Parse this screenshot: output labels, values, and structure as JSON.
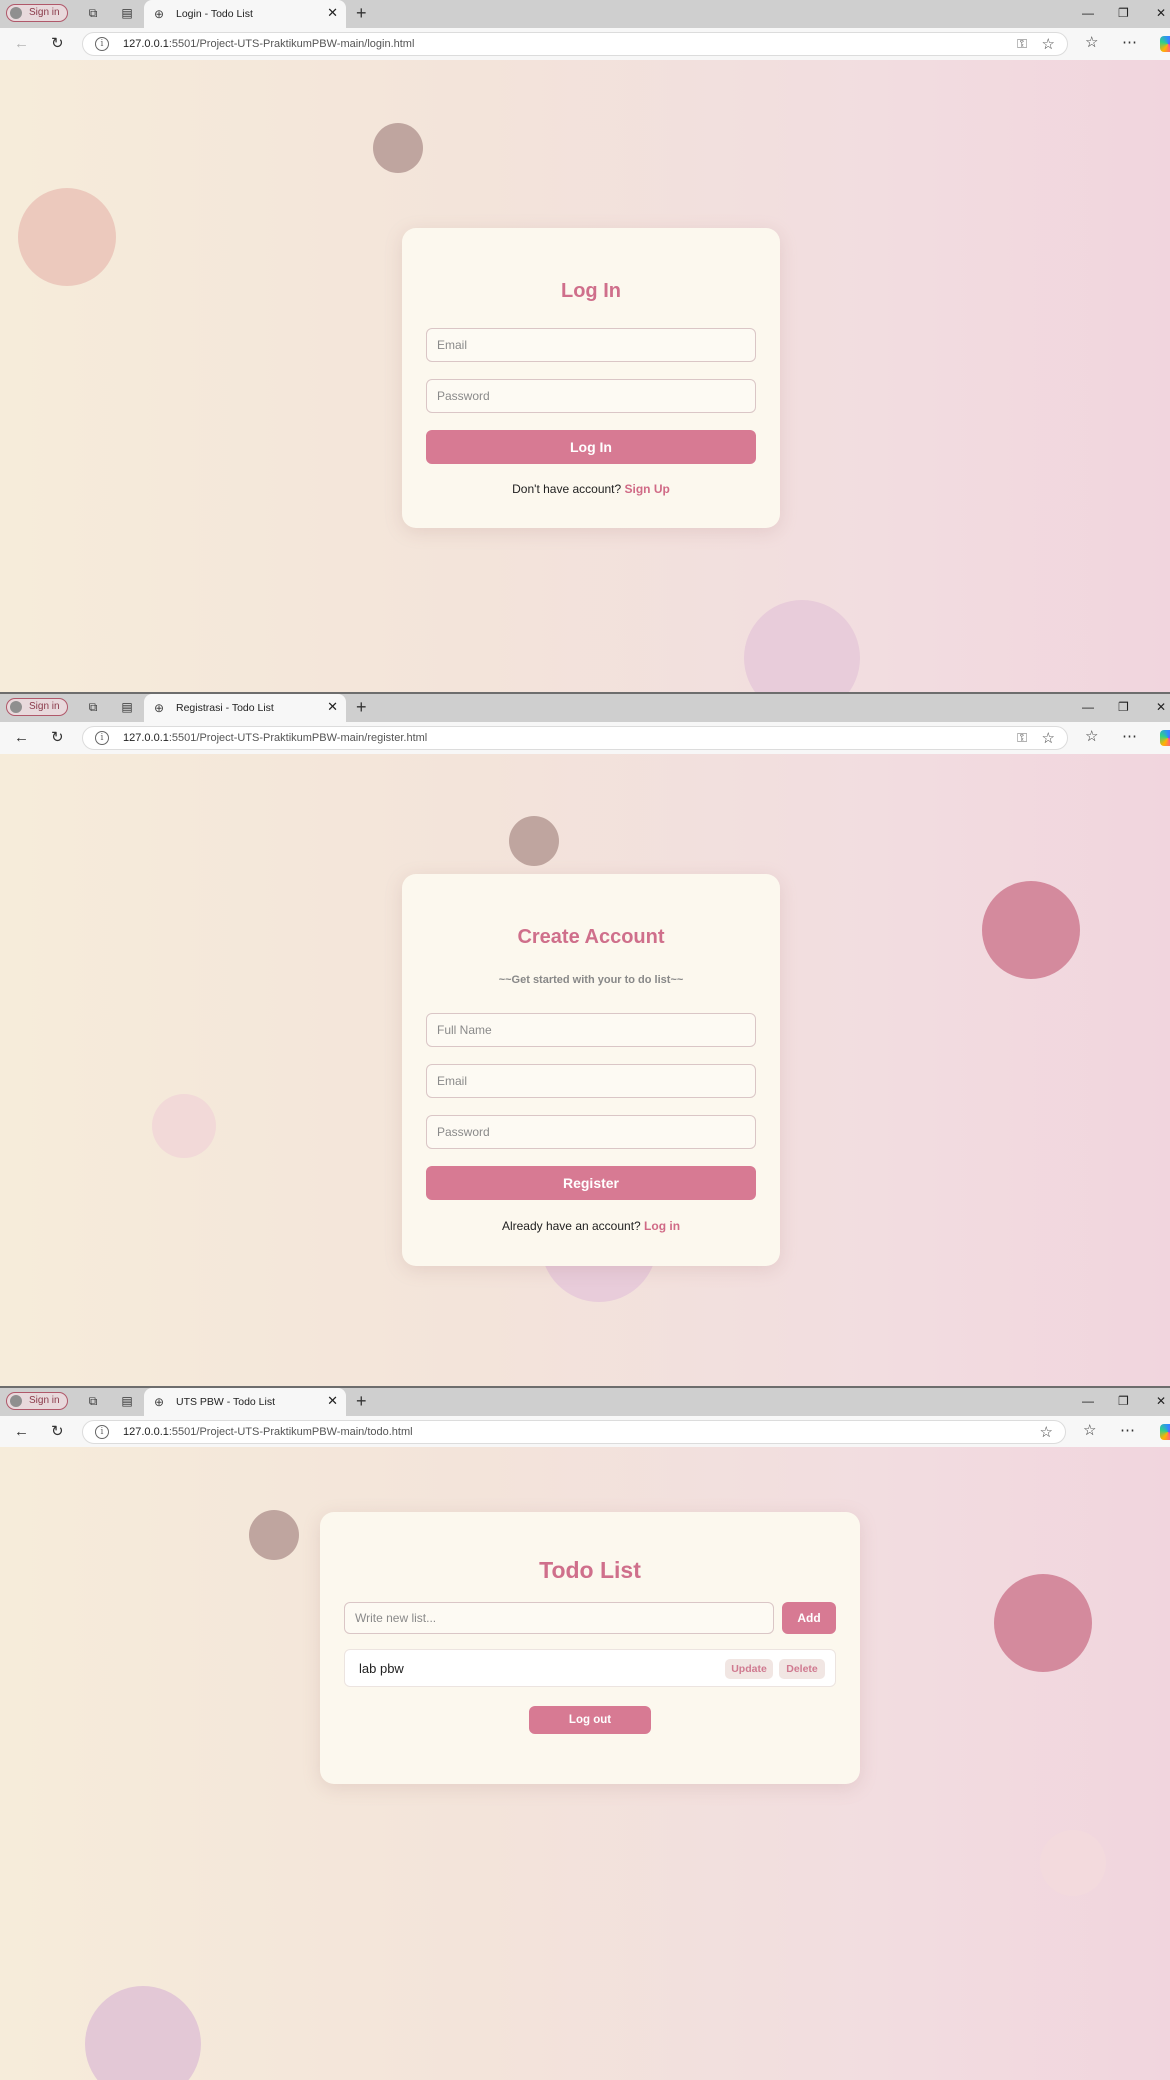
{
  "browser": {
    "sign_in_label": "Sign in",
    "screens": [
      {
        "tab_title": "Login - Todo List",
        "url_host": "127.0.0.1",
        "url_rest": ":5501/Project-UTS-PraktikumPBW-main/login.html"
      },
      {
        "tab_title": "Registrasi - Todo List",
        "url_host": "127.0.0.1",
        "url_rest": ":5501/Project-UTS-PraktikumPBW-main/register.html"
      },
      {
        "tab_title": "UTS PBW - Todo List",
        "url_host": "127.0.0.1",
        "url_rest": ":5501/Project-UTS-PraktikumPBW-main/todo.html"
      }
    ]
  },
  "login": {
    "title": "Log In",
    "email_placeholder": "Email",
    "password_placeholder": "Password",
    "submit_label": "Log In",
    "footer_text": "Don't have account?",
    "footer_link": "Sign Up"
  },
  "register": {
    "title": "Create Account",
    "subtitle": "~~Get started with your to do list~~",
    "fullname_placeholder": "Full Name",
    "email_placeholder": "Email",
    "password_placeholder": "Password",
    "submit_label": "Register",
    "footer_text": "Already have an account?",
    "footer_link": "Log in"
  },
  "todo": {
    "title": "Todo List",
    "input_placeholder": "Write new list...",
    "add_label": "Add",
    "items": [
      {
        "text": "lab pbw",
        "update_label": "Update",
        "delete_label": "Delete"
      }
    ],
    "logout_label": "Log out"
  },
  "colors": {
    "accent": "#d77a93",
    "title": "#cf6f8b",
    "card": "#fcf8ee"
  }
}
